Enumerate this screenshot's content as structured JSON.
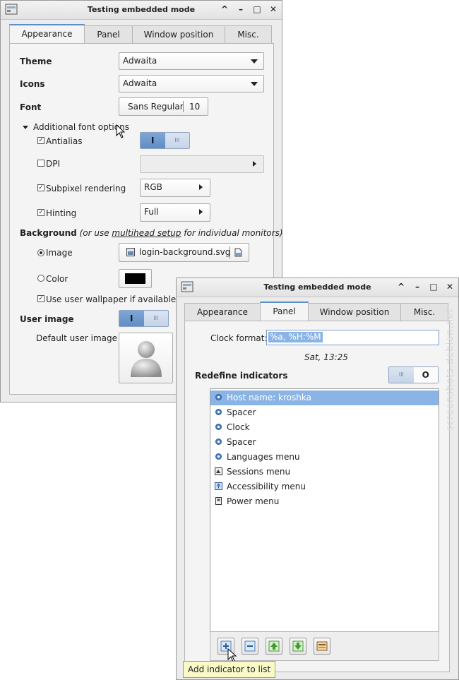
{
  "window1": {
    "title": "Testing embedded mode",
    "tabs": [
      "Appearance",
      "Panel",
      "Window position",
      "Misc."
    ],
    "theme_label": "Theme",
    "theme_value": "Adwaita",
    "icons_label": "Icons",
    "icons_value": "Adwaita",
    "font_label": "Font",
    "font_name": "Sans Regular",
    "font_size": "10",
    "additional_font_options": "Additional font options",
    "antialias_label": "Antialias",
    "dpi_label": "DPI",
    "subpixel_label": "Subpixel rendering",
    "subpixel_value": "RGB",
    "hinting_label": "Hinting",
    "hinting_value": "Full",
    "background_label": "Background",
    "background_hint_pre": "(or use ",
    "background_hint_link": "multihead setup",
    "background_hint_post": " for individual monitors)",
    "image_label": "Image",
    "image_file": "login-background.svg",
    "color_label": "Color",
    "wallpaper_label": "Use user wallpaper if available",
    "user_image_label": "User image",
    "default_user_image_label": "Default user image",
    "switch_on_glyph": "I",
    "switch_off_glyph": "III"
  },
  "window2": {
    "title": "Testing embedded mode",
    "tabs": [
      "Appearance",
      "Panel",
      "Window position",
      "Misc."
    ],
    "clock_format_label": "Clock format:",
    "clock_format_value": "%a, %H:%M",
    "clock_preview": "Sat, 13:25",
    "redefine_label": "Redefine indicators",
    "switch_off_glyph": "III",
    "switch_circle_glyph": "O",
    "indicators": [
      {
        "label": "Host name: kroshka",
        "icon": "gear-icon"
      },
      {
        "label": "Spacer",
        "icon": "gear-icon"
      },
      {
        "label": "Clock",
        "icon": "gear-icon"
      },
      {
        "label": "Spacer",
        "icon": "gear-icon"
      },
      {
        "label": "Languages menu",
        "icon": "gear-icon"
      },
      {
        "label": "Sessions menu",
        "icon": "sessions-icon"
      },
      {
        "label": "Accessibility menu",
        "icon": "accessibility-icon"
      },
      {
        "label": "Power menu",
        "icon": "power-icon"
      }
    ],
    "tooltip": "Add indicator to list"
  },
  "watermark": "screenshots.debian.net",
  "colors": {
    "accent": "#5f8dc6",
    "selection": "#8ab4e6",
    "window_bg": "#ececec"
  }
}
